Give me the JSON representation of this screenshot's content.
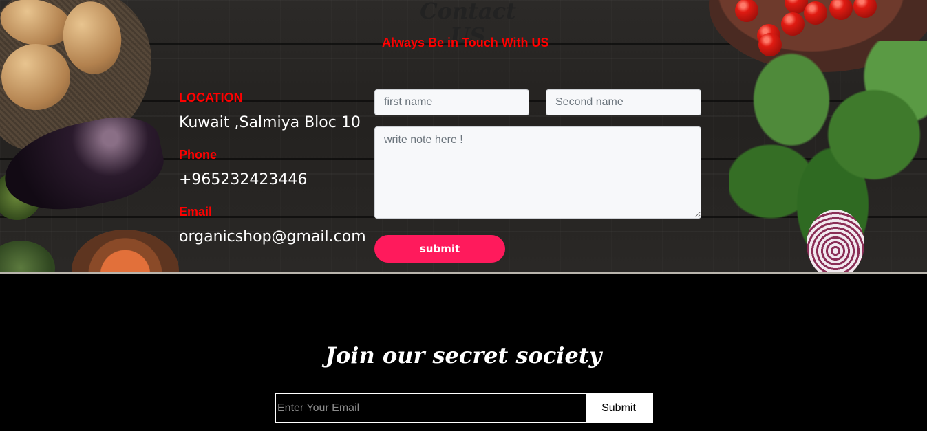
{
  "contact": {
    "title": "Contact US",
    "subtitle": "Always Be in Touch With US",
    "location_label": "LOCATION",
    "location_value": "Kuwait ,Salmiya Bloc 10",
    "phone_label": "Phone",
    "phone_value": "+965232423446",
    "email_label": "Email",
    "email_value": "organicshop@gmail.com",
    "form": {
      "first_name_placeholder": "first name",
      "second_name_placeholder": "Second name",
      "note_placeholder": "write note here !",
      "submit_label": "submit"
    },
    "colors": {
      "label": "#ff0000",
      "submit": "#ff1a5c"
    }
  },
  "newsletter": {
    "title": "Join our secret society",
    "email_placeholder": "Enter Your Email",
    "submit_label": "Submit"
  }
}
